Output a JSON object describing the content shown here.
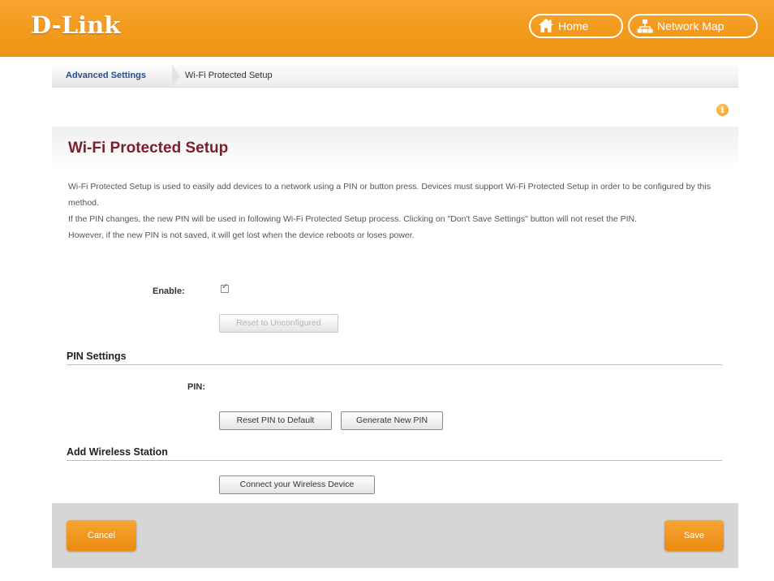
{
  "header": {
    "logo": "D-Link",
    "home_label": "Home",
    "network_map_label": "Network Map"
  },
  "breadcrumb": {
    "parent": "Advanced Settings",
    "current": "Wi-Fi Protected Setup"
  },
  "panel": {
    "title": "Wi-Fi Protected Setup",
    "desc": [
      "Wi-Fi Protected Setup is used to easily add devices to a network using a PIN or button press. Devices must support Wi-Fi Protected Setup in order to be configured by this method.",
      "If the PIN changes, the new PIN will be used in following Wi-Fi Protected Setup process. Clicking on \"Don't Save Settings\" button will not reset the PIN.",
      "However, if the new PIN is not saved, it will get lost when the device reboots or loses power."
    ],
    "enable_label": "Enable:",
    "enable_checked": true,
    "reset_unconfigured_label": "Reset to Unconfigured"
  },
  "pin_settings": {
    "heading": "PIN Settings",
    "pin_label": "PIN:",
    "pin_value": "",
    "reset_pin_label": "Reset PIN to Default",
    "generate_pin_label": "Generate New PIN"
  },
  "add_station": {
    "heading": "Add Wireless Station",
    "connect_label": "Connect your Wireless Device"
  },
  "footer": {
    "cancel_label": "Cancel",
    "save_label": "Save"
  },
  "colors": {
    "brand_orange": "#f29a1c",
    "title_maroon": "#7a1f2b",
    "link_blue": "#2a4c8a"
  }
}
